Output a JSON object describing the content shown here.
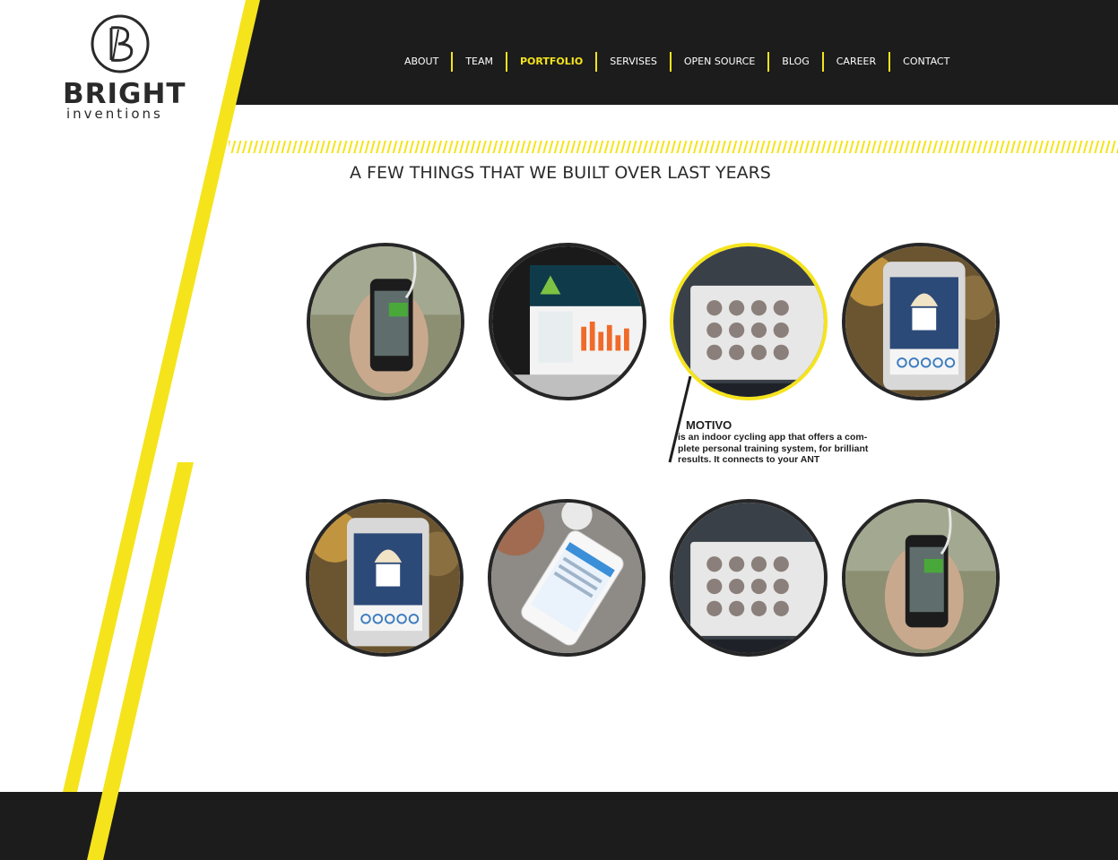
{
  "brand": {
    "name": "BRIGHT",
    "sub": "inventions",
    "accent": "#f5e41c",
    "dark": "#1c1c1c"
  },
  "nav": {
    "items": [
      {
        "label": "ABOUT",
        "active": false
      },
      {
        "label": "TEAM",
        "active": false
      },
      {
        "label": "PORTFOLIO",
        "active": true
      },
      {
        "label": "SERVISES",
        "active": false
      },
      {
        "label": "OPEN SOURCE",
        "active": false
      },
      {
        "label": "BLOG",
        "active": false
      },
      {
        "label": "CAREER",
        "active": false
      },
      {
        "label": "CONTACT",
        "active": false
      }
    ]
  },
  "portfolio": {
    "headline": "A FEW THINGS THAT WE BUILT OVER LAST YEARS",
    "tooltip": {
      "title": "MOTIVO",
      "description": " is an indoor cycling app that offers a com-\n plete personal training system, for brilliant\nresults. It connects to your ANT"
    },
    "items": [
      {
        "image": "phone-in-hand-icon"
      },
      {
        "image": "laptop-dashboard-icon"
      },
      {
        "image": "tablet-products-icon",
        "selected": true
      },
      {
        "image": "phone-icecream-icon"
      },
      {
        "image": "phone-icecream-icon"
      },
      {
        "image": "phone-on-table-icon"
      },
      {
        "image": "tablet-products-icon"
      },
      {
        "image": "phone-in-hand-icon"
      }
    ]
  }
}
